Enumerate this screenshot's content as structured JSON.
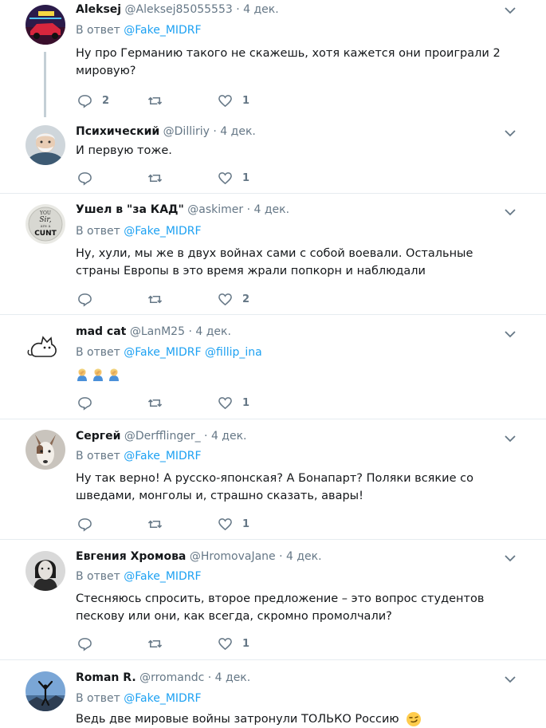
{
  "tweets": [
    {
      "name": "Aleksej",
      "handle": "@Aleksej85055553",
      "date": "4 дек.",
      "reply_prefix": "В ответ",
      "reply_to": [
        "@Fake_MIDRF"
      ],
      "text": "Ну про Германию такого не скажешь, хотя кажется они проиграли 2 мировую?",
      "reply_count": "2",
      "retweet_count": "",
      "like_count": "1",
      "avatar": "red-car-neon"
    },
    {
      "name": "Психический",
      "handle": "@Dilliriy",
      "date": "4 дек.",
      "reply_prefix": "",
      "reply_to": [],
      "text": "И первую тоже.",
      "reply_count": "",
      "retweet_count": "",
      "like_count": "1",
      "avatar": "old-man"
    },
    {
      "name": "Ушел в \"за КАД\"",
      "handle": "@askimer",
      "date": "4 дек.",
      "reply_prefix": "В ответ",
      "reply_to": [
        "@Fake_MIDRF"
      ],
      "text": "Ну, хули, мы же в двух войнах сами с собой воевали. Остальные страны Европы в это время жрали попкорн и наблюдали",
      "reply_count": "",
      "retweet_count": "",
      "like_count": "2",
      "avatar": "text-badge",
      "avatar_text": [
        "YOU",
        "Sir,",
        "are a",
        "CUNT"
      ]
    },
    {
      "name": "mad cat",
      "handle": "@LanM25",
      "date": "4 дек.",
      "reply_prefix": "В ответ",
      "reply_to": [
        "@Fake_MIDRF",
        "@fillip_ina"
      ],
      "text": "",
      "emoji_count": 3,
      "emoji_name": "man-facepalming-emoji",
      "reply_count": "",
      "retweet_count": "",
      "like_count": "1",
      "avatar": "cartoon-cat"
    },
    {
      "name": "Сергей",
      "handle": "@Derfflinger_",
      "date": "4 дек.",
      "reply_prefix": "В ответ",
      "reply_to": [
        "@Fake_MIDRF"
      ],
      "text": "Ну так верно! А русско-японская? А Бонапарт? Поляки всякие со шведами, монголы и, страшно сказать, авары!",
      "reply_count": "",
      "retweet_count": "",
      "like_count": "1",
      "avatar": "dog"
    },
    {
      "name": "Евгения Хромова",
      "handle": "@HromovaJane",
      "date": "4 дек.",
      "reply_prefix": "В ответ",
      "reply_to": [
        "@Fake_MIDRF"
      ],
      "text": "Стесняюсь спросить, второе предложение – это вопрос студентов пескову или они, как всегда, скромно промолчали?",
      "reply_count": "",
      "retweet_count": "",
      "like_count": "1",
      "avatar": "woman-portrait"
    },
    {
      "name": "Roman R.",
      "handle": "@rromandc",
      "date": "4 дек.",
      "reply_prefix": "В ответ",
      "reply_to": [
        "@Fake_MIDRF"
      ],
      "text": "Ведь две мировые войны затронули ТОЛЬКО Россию",
      "trailing_emoji": "smirking-face-emoji",
      "reply_count": "",
      "retweet_count": "",
      "like_count": "",
      "avatar": "silhouette-sky"
    }
  ],
  "colors": {
    "link": "#1da1f2",
    "secondary": "#657786",
    "divider": "#e6ecf0",
    "thread_line": "#c4cfd6"
  }
}
